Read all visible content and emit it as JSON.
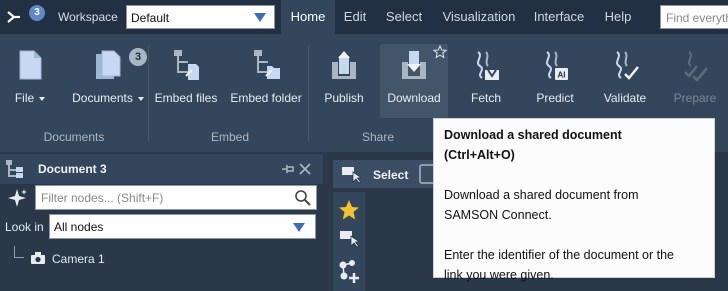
{
  "topbar": {
    "badge": "3",
    "workspace_label": "Workspace",
    "workspace_value": "Default",
    "menu": [
      "Home",
      "Edit",
      "Select",
      "Visualization",
      "Interface",
      "Help"
    ],
    "active_menu": "Home",
    "find_placeholder": "Find everything"
  },
  "ribbon": {
    "buttons": [
      {
        "label": "File",
        "icon": "file-icon",
        "dropdown": true
      },
      {
        "label": "Documents",
        "icon": "documents-icon",
        "dropdown": true,
        "badge": "3"
      },
      {
        "label": "Embed files",
        "icon": "embed-files-icon"
      },
      {
        "label": "Embed folder",
        "icon": "embed-folder-icon"
      },
      {
        "label": "Publish",
        "icon": "publish-icon"
      },
      {
        "label": "Download",
        "icon": "download-icon",
        "highlighted": true
      },
      {
        "label": "Fetch",
        "icon": "fetch-icon"
      },
      {
        "label": "Predict",
        "icon": "predict-icon"
      },
      {
        "label": "Validate",
        "icon": "validate-icon"
      },
      {
        "label": "Prepare",
        "icon": "prepare-icon",
        "disabled": true
      }
    ],
    "groups": [
      "Documents",
      "Embed",
      "Share"
    ]
  },
  "document_panel": {
    "title": "Document 3",
    "filter_placeholder": "Filter nodes... (Shift+F)",
    "lookin_label": "Look in",
    "lookin_value": "All nodes",
    "tree": [
      {
        "label": "Camera 1",
        "icon": "camera-icon"
      }
    ]
  },
  "viewport": {
    "tab_label": "Select"
  },
  "tooltip": {
    "title_line1": "Download a shared document",
    "title_line2": "(Ctrl+Alt+O)",
    "body1_line1": "Download a shared document from",
    "body1_line2": "SAMSON Connect.",
    "body2_line1": "Enter the identifier of the document or the",
    "body2_line2": "link you were given."
  },
  "colors": {
    "topbar": "#213042",
    "ribbon": "#33465c",
    "panel": "#2a3849",
    "accent": "#3d6fb0",
    "star": "#f2c230"
  }
}
